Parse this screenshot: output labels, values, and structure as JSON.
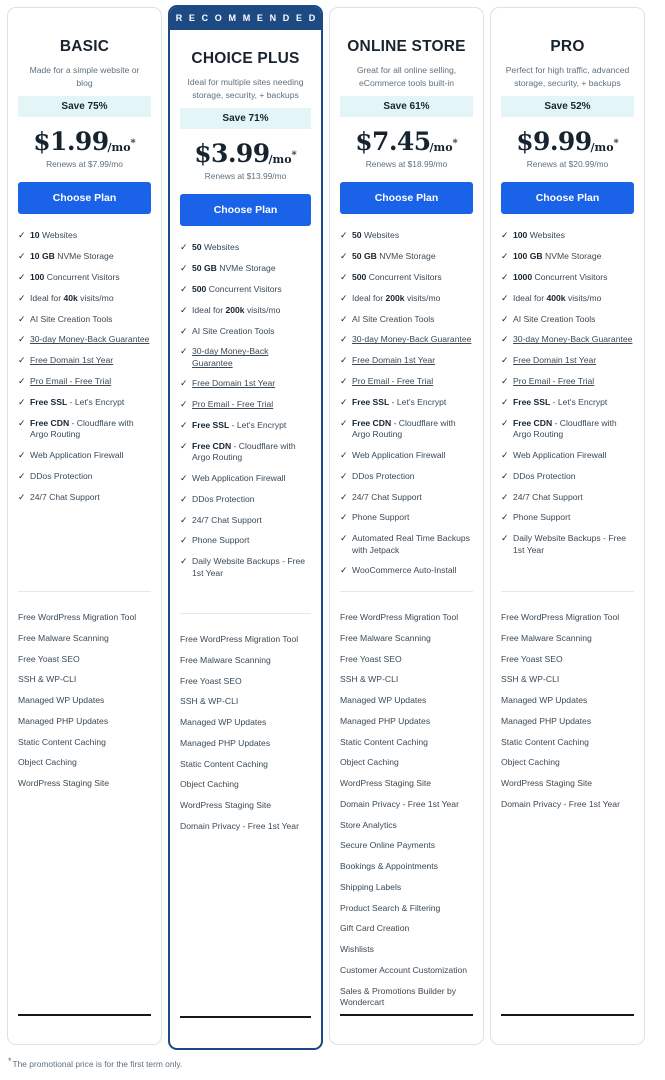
{
  "footnote": {
    "star": "*",
    "text": "The promotional price is for the first term only."
  },
  "labels": {
    "recommended": "R E C O M M E N D E D",
    "cta": "Choose Plan",
    "check_icon": "check-icon"
  },
  "plans": [
    {
      "name": "BASIC",
      "tagline": "Made for a simple website or blog",
      "save": "Save 75%",
      "price": "$1.99",
      "price_suffix": "/mo",
      "price_star": "*",
      "renews": "Renews at $7.99/mo",
      "cta": "Choose Plan",
      "recommended": false,
      "features": [
        {
          "bold": "10",
          "text": " Websites"
        },
        {
          "bold": "10 GB",
          "text": " NVMe Storage"
        },
        {
          "bold": "100",
          "text": " Concurrent Visitors"
        },
        {
          "pre": "Ideal for ",
          "bold": "40k",
          "text": " visits/mo"
        },
        {
          "text": "AI Site Creation Tools"
        },
        {
          "link": "30-day Money-Back Guarantee"
        },
        {
          "link": "Free Domain 1st Year"
        },
        {
          "link": "Pro Email - Free Trial"
        },
        {
          "bold": "Free SSL",
          "text": " - Let's Encrypt"
        },
        {
          "bold": "Free CDN",
          "text": " - Cloudflare with Argo Routing"
        },
        {
          "text": "Web Application Firewall"
        },
        {
          "text": "DDos Protection"
        },
        {
          "text": "24/7 Chat Support"
        }
      ],
      "extras": [
        "Free WordPress Migration Tool",
        "Free Malware Scanning",
        "Free Yoast SEO",
        "SSH & WP-CLI",
        "Managed WP Updates",
        "Managed PHP Updates",
        "Static Content Caching",
        "Object Caching",
        "WordPress Staging Site"
      ]
    },
    {
      "name": "CHOICE PLUS",
      "tagline": "Ideal for multiple sites needing storage, security, + backups",
      "save": "Save 71%",
      "price": "$3.99",
      "price_suffix": "/mo",
      "price_star": "*",
      "renews": "Renews at $13.99/mo",
      "cta": "Choose Plan",
      "recommended": true,
      "features": [
        {
          "bold": "50",
          "text": " Websites"
        },
        {
          "bold": "50 GB",
          "text": " NVMe Storage"
        },
        {
          "bold": "500",
          "text": " Concurrent Visitors"
        },
        {
          "pre": "Ideal for ",
          "bold": "200k",
          "text": " visits/mo"
        },
        {
          "text": "AI Site Creation Tools"
        },
        {
          "link": "30-day Money-Back Guarantee"
        },
        {
          "link": "Free Domain 1st Year"
        },
        {
          "link": "Pro Email - Free Trial"
        },
        {
          "bold": "Free SSL",
          "text": " - Let's Encrypt"
        },
        {
          "bold": "Free CDN",
          "text": " - Cloudflare with Argo Routing"
        },
        {
          "text": "Web Application Firewall"
        },
        {
          "text": "DDos Protection"
        },
        {
          "text": "24/7 Chat Support"
        },
        {
          "text": "Phone Support"
        },
        {
          "text": "Daily Website Backups - Free 1st Year"
        }
      ],
      "extras": [
        "Free WordPress Migration Tool",
        "Free Malware Scanning",
        "Free Yoast SEO",
        "SSH & WP-CLI",
        "Managed WP Updates",
        "Managed PHP Updates",
        "Static Content Caching",
        "Object Caching",
        "WordPress Staging Site",
        "Domain Privacy - Free 1st Year"
      ]
    },
    {
      "name": "ONLINE STORE",
      "tagline": "Great for all online selling, eCommerce tools built-in",
      "save": "Save 61%",
      "price": "$7.45",
      "price_suffix": "/mo",
      "price_star": "*",
      "renews": "Renews at $18.99/mo",
      "cta": "Choose Plan",
      "recommended": false,
      "features": [
        {
          "bold": "50",
          "text": " Websites"
        },
        {
          "bold": "50 GB",
          "text": " NVMe Storage"
        },
        {
          "bold": "500",
          "text": " Concurrent Visitors"
        },
        {
          "pre": "Ideal for ",
          "bold": "200k",
          "text": " visits/mo"
        },
        {
          "text": "AI Site Creation Tools"
        },
        {
          "link": "30-day Money-Back Guarantee"
        },
        {
          "link": "Free Domain 1st Year"
        },
        {
          "link": "Pro Email - Free Trial"
        },
        {
          "bold": "Free SSL",
          "text": " - Let's Encrypt"
        },
        {
          "bold": "Free CDN",
          "text": " - Cloudflare with Argo Routing"
        },
        {
          "text": "Web Application Firewall"
        },
        {
          "text": "DDos Protection"
        },
        {
          "text": "24/7 Chat Support"
        },
        {
          "text": "Phone Support"
        },
        {
          "text": "Automated Real Time Backups with Jetpack"
        },
        {
          "text": "WooCommerce Auto-Install"
        }
      ],
      "extras": [
        "Free WordPress Migration Tool",
        "Free Malware Scanning",
        "Free Yoast SEO",
        "SSH & WP-CLI",
        "Managed WP Updates",
        "Managed PHP Updates",
        "Static Content Caching",
        "Object Caching",
        "WordPress Staging Site",
        "Domain Privacy - Free 1st Year",
        "Store Analytics",
        "Secure Online Payments",
        "Bookings & Appointments",
        "Shipping Labels",
        "Product Search & Filtering",
        "Gift Card Creation",
        "Wishlists",
        "Customer Account Customization",
        "Sales & Promotions Builder by Wondercart"
      ]
    },
    {
      "name": "PRO",
      "tagline": "Perfect for high traffic, advanced storage, security, + backups",
      "save": "Save 52%",
      "price": "$9.99",
      "price_suffix": "/mo",
      "price_star": "*",
      "renews": "Renews at $20.99/mo",
      "cta": "Choose Plan",
      "recommended": false,
      "features": [
        {
          "bold": "100",
          "text": " Websites"
        },
        {
          "bold": "100 GB",
          "text": " NVMe Storage"
        },
        {
          "bold": "1000",
          "text": " Concurrent Visitors"
        },
        {
          "pre": "Ideal for ",
          "bold": "400k",
          "text": " visits/mo"
        },
        {
          "text": "AI Site Creation Tools"
        },
        {
          "link": "30-day Money-Back Guarantee"
        },
        {
          "link": "Free Domain 1st Year"
        },
        {
          "link": "Pro Email - Free Trial"
        },
        {
          "bold": "Free SSL",
          "text": " - Let's Encrypt"
        },
        {
          "bold": "Free CDN",
          "text": " - Cloudflare with Argo Routing"
        },
        {
          "text": "Web Application Firewall"
        },
        {
          "text": "DDos Protection"
        },
        {
          "text": "24/7 Chat Support"
        },
        {
          "text": "Phone Support"
        },
        {
          "text": "Daily Website Backups - Free 1st Year"
        }
      ],
      "extras": [
        "Free WordPress Migration Tool",
        "Free Malware Scanning",
        "Free Yoast SEO",
        "SSH & WP-CLI",
        "Managed WP Updates",
        "Managed PHP Updates",
        "Static Content Caching",
        "Object Caching",
        "WordPress Staging Site",
        "Domain Privacy - Free 1st Year"
      ]
    }
  ],
  "colors": {
    "accent_button": "#1a62e8",
    "ribbon": "#1d4a82",
    "save_badge_bg": "#e4f5f7",
    "card_border": "#d9e3e8",
    "text": "#3b4a56"
  }
}
